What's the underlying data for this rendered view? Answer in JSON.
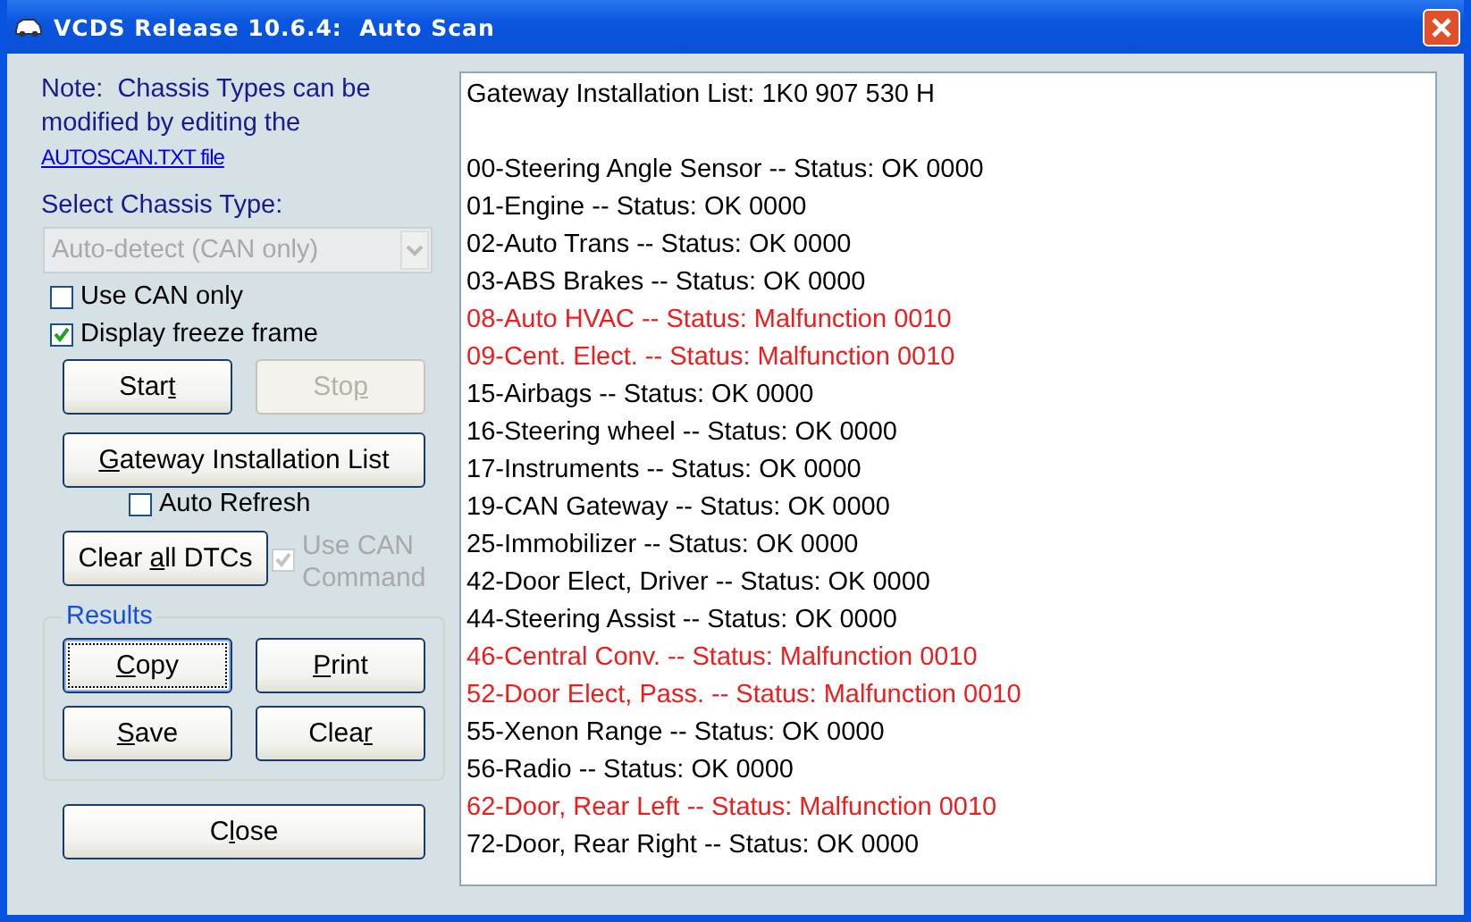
{
  "window": {
    "title": "VCDS Release 10.6.4:  Auto Scan"
  },
  "note": {
    "text": "Note:  Chassis Types can be modified by editing the",
    "link": "AUTOSCAN.TXT file"
  },
  "chassis": {
    "label": "Select Chassis Type:",
    "value": "Auto-detect (CAN only)",
    "disabled": true
  },
  "options": [
    {
      "label": "Use CAN only",
      "checked": false
    },
    {
      "label": "Display freeze frame",
      "checked": true
    }
  ],
  "run_buttons": [
    {
      "before": "Star",
      "key": "t",
      "disabled": false,
      "focused": false
    },
    {
      "before": "Sto",
      "key": "p",
      "disabled": true,
      "focused": false
    }
  ],
  "gateway_button": {
    "key": "G",
    "after": "ateway Installation List"
  },
  "auto_refresh": {
    "label": "Auto Refresh",
    "checked": false
  },
  "clear_dtcs_button": {
    "before": "Clear ",
    "key": "a",
    "after": "ll DTCs"
  },
  "use_can_command": {
    "label": "Use CAN Command",
    "checked": true,
    "disabled": true
  },
  "results": {
    "title": "Results",
    "buttons": [
      {
        "key": "C",
        "after": "opy",
        "disabled": false,
        "focused": true
      },
      {
        "key": "P",
        "after": "rint",
        "disabled": false,
        "focused": false
      },
      {
        "key": "S",
        "after": "ave",
        "disabled": false,
        "focused": false
      },
      {
        "before": "Clea",
        "key": "r",
        "disabled": false,
        "focused": false
      }
    ]
  },
  "close_button": {
    "before": "C",
    "key": "l",
    "after": "ose"
  },
  "output": {
    "header": "Gateway Installation List:  1K0 907 530 H",
    "lines": [
      {
        "text": "00-Steering Angle Sensor -- Status: OK 0000",
        "fault": false
      },
      {
        "text": "01-Engine -- Status: OK 0000",
        "fault": false
      },
      {
        "text": "02-Auto Trans -- Status: OK 0000",
        "fault": false
      },
      {
        "text": "03-ABS Brakes -- Status: OK 0000",
        "fault": false
      },
      {
        "text": "08-Auto HVAC -- Status: Malfunction 0010",
        "fault": true
      },
      {
        "text": "09-Cent. Elect. -- Status: Malfunction 0010",
        "fault": true
      },
      {
        "text": "15-Airbags -- Status: OK 0000",
        "fault": false
      },
      {
        "text": "16-Steering wheel -- Status: OK 0000",
        "fault": false
      },
      {
        "text": "17-Instruments -- Status: OK 0000",
        "fault": false
      },
      {
        "text": "19-CAN Gateway -- Status: OK 0000",
        "fault": false
      },
      {
        "text": "25-Immobilizer -- Status: OK 0000",
        "fault": false
      },
      {
        "text": "42-Door Elect, Driver -- Status: OK 0000",
        "fault": false
      },
      {
        "text": "44-Steering Assist -- Status: OK 0000",
        "fault": false
      },
      {
        "text": "46-Central Conv. -- Status: Malfunction 0010",
        "fault": true
      },
      {
        "text": "52-Door Elect, Pass. -- Status: Malfunction 0010",
        "fault": true
      },
      {
        "text": "55-Xenon Range -- Status: OK 0000",
        "fault": false
      },
      {
        "text": "56-Radio -- Status: OK 0000",
        "fault": false
      },
      {
        "text": "62-Door, Rear Left -- Status: Malfunction 0010",
        "fault": true
      },
      {
        "text": "72-Door, Rear Right -- Status: OK 0000",
        "fault": false
      }
    ]
  }
}
